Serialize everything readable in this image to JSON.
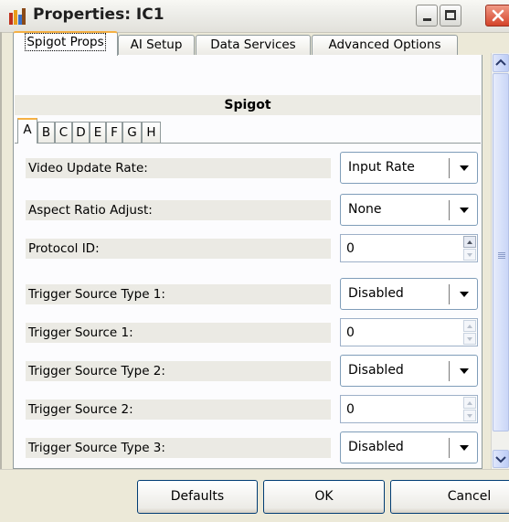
{
  "window": {
    "title": "Properties: IC1"
  },
  "tabs": [
    {
      "label": "Spigot Props",
      "active": true
    },
    {
      "label": "AI Setup",
      "active": false
    },
    {
      "label": "Data Services",
      "active": false
    },
    {
      "label": "Advanced Options",
      "active": false
    }
  ],
  "group": {
    "title": "Spigot"
  },
  "subtabs": [
    "A",
    "B",
    "C",
    "D",
    "E",
    "F",
    "G",
    "H"
  ],
  "active_subtab": "A",
  "properties": [
    {
      "label": "Video Update Rate:",
      "type": "combo",
      "value": "Input Rate"
    },
    {
      "label": "Aspect Ratio Adjust:",
      "type": "combo",
      "value": "None"
    },
    {
      "label": "Protocol ID:",
      "type": "spin",
      "value": "0"
    },
    {
      "label": "Trigger Source Type 1:",
      "type": "combo",
      "value": "Disabled"
    },
    {
      "label": "Trigger Source 1:",
      "type": "spin",
      "value": "0"
    },
    {
      "label": "Trigger Source Type 2:",
      "type": "combo",
      "value": "Disabled"
    },
    {
      "label": "Trigger Source 2:",
      "type": "spin",
      "value": "0"
    },
    {
      "label": "Trigger Source Type 3:",
      "type": "combo",
      "value": "Disabled"
    }
  ],
  "buttons": {
    "defaults": "Defaults",
    "ok": "OK",
    "cancel": "Cancel"
  },
  "colors": {
    "tab_highlight": "#f5b043",
    "button_border": "#003c74",
    "close_button": "#d4432a",
    "label_background": "#ebeae4"
  },
  "icons": {
    "app": "properties-icon",
    "minimize": "minimize-icon",
    "maximize": "maximize-icon",
    "close": "close-icon"
  }
}
